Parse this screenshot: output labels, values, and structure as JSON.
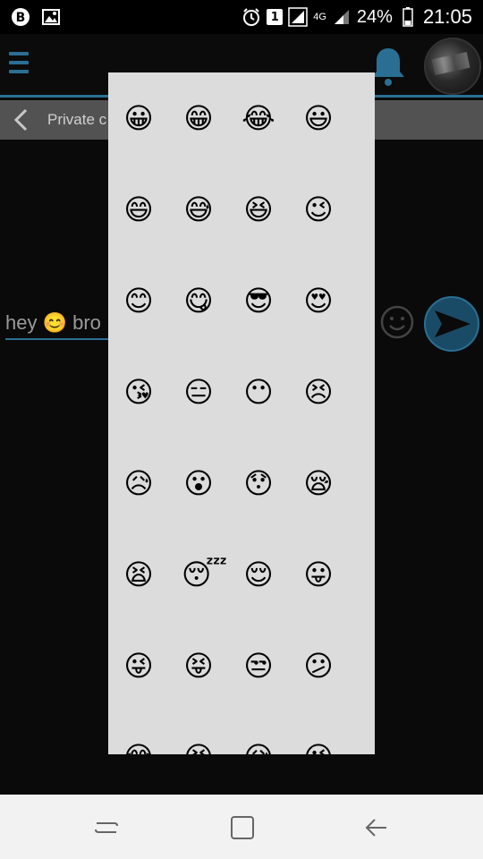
{
  "status_bar": {
    "network_type": "4G",
    "battery_percent": "24%",
    "time": "21:05",
    "notification_count": "1"
  },
  "app": {
    "sub_title": "Private c",
    "message_text": "hey 😊 bro"
  },
  "emoji_picker": {
    "emojis": [
      "😀",
      "😁",
      "😂",
      "😃",
      "😄",
      "😅",
      "😆",
      "😉",
      "😊",
      "😋",
      "😎",
      "😍",
      "😘",
      "😑",
      "😶",
      "😣",
      "😥",
      "😮",
      "😯",
      "😪",
      "😫",
      "😴",
      "😌",
      "😛",
      "😜",
      "😝",
      "😒",
      "😕",
      "😂",
      "😆",
      "😥",
      "😉"
    ]
  },
  "colors": {
    "accent": "#2a6f93",
    "popup_bg": "#dcdcdc"
  }
}
